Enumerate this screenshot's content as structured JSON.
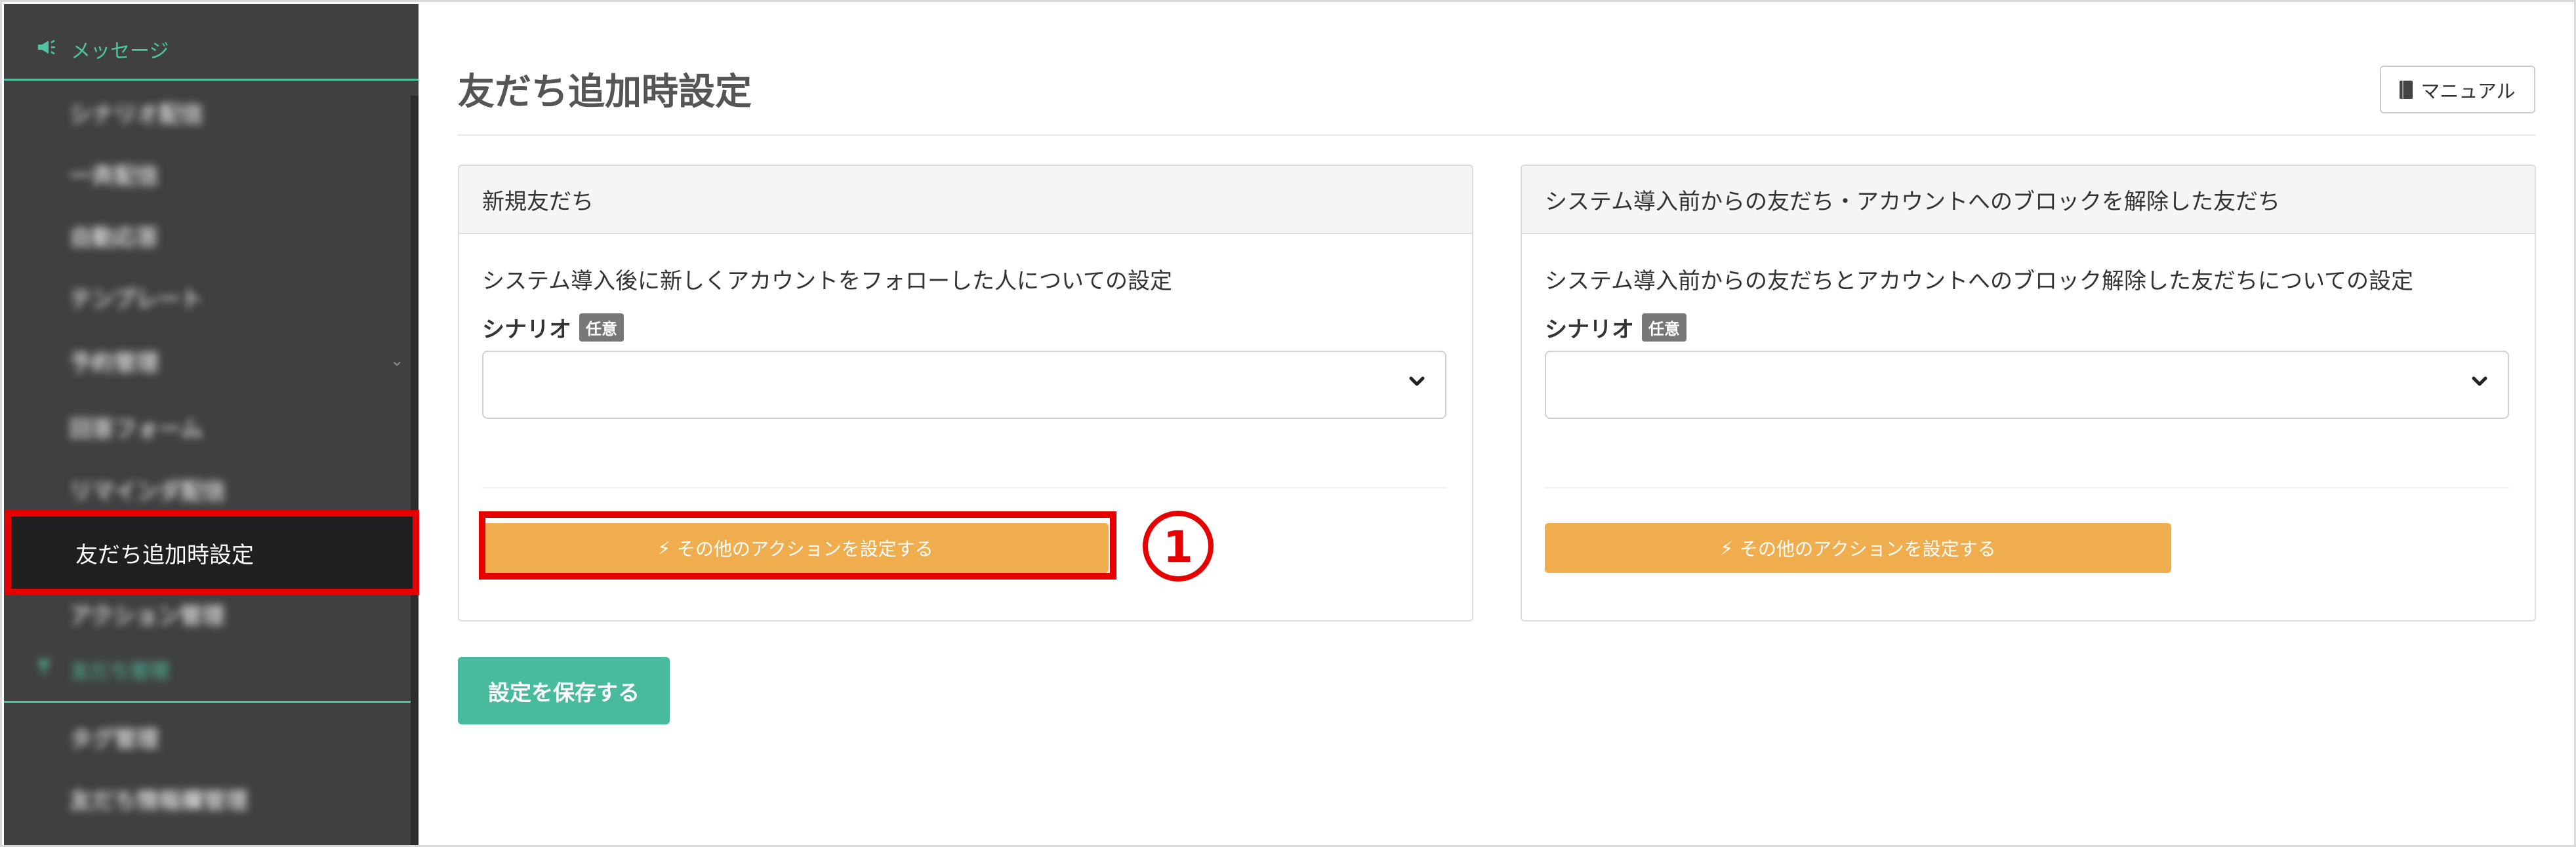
{
  "sidebar": {
    "messages_section": {
      "label": "メッセージ",
      "icon": "megaphone-icon"
    },
    "items": [
      {
        "label": "シナリオ配信"
      },
      {
        "label": "一斉配信"
      },
      {
        "label": "自動応答"
      },
      {
        "label": "テンプレート"
      },
      {
        "label": "予約管理"
      },
      {
        "label": "回答フォーム"
      },
      {
        "label": "リマインダ配信"
      }
    ],
    "active_item": {
      "label": "友だち追加時設定"
    },
    "items_after": [
      {
        "label": "アクション管理"
      }
    ],
    "friends_section": {
      "label": "友だち管理",
      "icon": "funnel-icon"
    },
    "friends_items": [
      {
        "label": "タグ管理"
      },
      {
        "label": "友だち情報欄管理"
      }
    ],
    "accent_color": "#4fc3a2",
    "background_color": "#404042"
  },
  "page": {
    "title": "友だち追加時設定",
    "manual_button": {
      "label": "マニュアル",
      "icon": "book-icon"
    }
  },
  "panels": [
    {
      "title": "新規友だち",
      "description": "システム導入後に新しくアカウントをフォローした人についての設定",
      "scenario_label": "シナリオ",
      "badge": "任意",
      "select_value": "",
      "action_button": "その他のアクションを設定する"
    },
    {
      "title": "システム導入前からの友だち・アカウントへのブロックを解除した友だち",
      "description": "システム導入前からの友だちとアカウントへのブロック解除した友だちについての設定",
      "scenario_label": "シナリオ",
      "badge": "任意",
      "select_value": "",
      "action_button": "その他のアクションを設定する"
    }
  ],
  "save_button": "設定を保存する",
  "annotation": {
    "marker": "1",
    "color": "#e60000"
  },
  "colors": {
    "action_button": "#f0ad4e",
    "save_button": "#48bb9f"
  }
}
